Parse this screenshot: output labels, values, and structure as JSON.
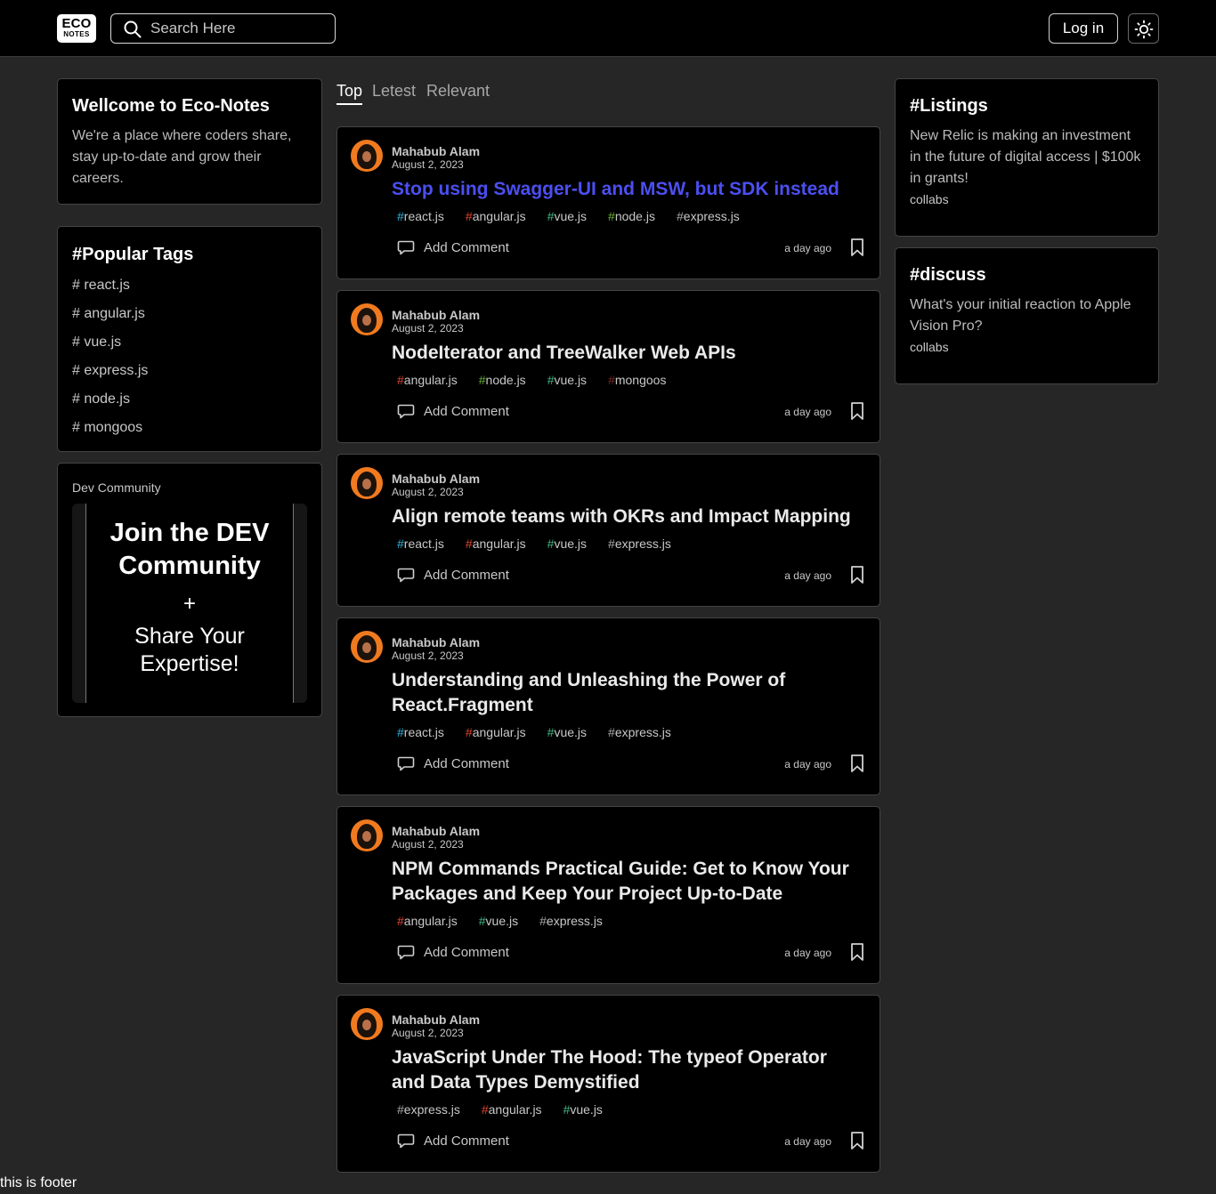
{
  "header": {
    "logo_top": "ECO",
    "logo_bottom": "NOTES",
    "search_placeholder": "Search Here",
    "login_label": "Log in"
  },
  "welcome": {
    "title": "Wellcome to Eco-Notes",
    "text": "We're a place where coders share, stay up-to-date and grow their careers."
  },
  "popular_tags": {
    "title": "#Popular Tags",
    "items": [
      "# react.js",
      "# angular.js",
      "# vue.js",
      "# express.js",
      "# node.js",
      "# mongoos"
    ]
  },
  "dev_community": {
    "caption": "Dev Community",
    "headline": "Join the DEV Community",
    "plus": "+",
    "subline": "Share Your Expertise!"
  },
  "tabs": [
    "Top",
    "Letest",
    "Relevant"
  ],
  "posts": [
    {
      "author": "Mahabub Alam",
      "date": "August 2, 2023",
      "title": "Stop using Swagger-UI and MSW, but SDK instead",
      "tags": [
        "react.js",
        "angular.js",
        "vue.js",
        "node.js",
        "express.js"
      ],
      "comment_label": "Add Comment",
      "time_ago": "a day ago"
    },
    {
      "author": "Mahabub Alam",
      "date": "August 2, 2023",
      "title": "NodeIterator and TreeWalker Web APIs",
      "tags": [
        "angular.js",
        "node.js",
        "vue.js",
        "mongoos"
      ],
      "comment_label": "Add Comment",
      "time_ago": "a day ago"
    },
    {
      "author": "Mahabub Alam",
      "date": "August 2, 2023",
      "title": "Align remote teams with OKRs and Impact Mapping",
      "tags": [
        "react.js",
        "angular.js",
        "vue.js",
        "express.js"
      ],
      "comment_label": "Add Comment",
      "time_ago": "a day ago"
    },
    {
      "author": "Mahabub Alam",
      "date": "August 2, 2023",
      "title": "Understanding and Unleashing the Power of React.Fragment",
      "tags": [
        "react.js",
        "angular.js",
        "vue.js",
        "express.js"
      ],
      "comment_label": "Add Comment",
      "time_ago": "a day ago"
    },
    {
      "author": "Mahabub Alam",
      "date": "August 2, 2023",
      "title": "NPM Commands Practical Guide: Get to Know Your Packages and Keep Your Project Up-to-Date",
      "tags": [
        "angular.js",
        "vue.js",
        "express.js"
      ],
      "comment_label": "Add Comment",
      "time_ago": "a day ago"
    },
    {
      "author": "Mahabub Alam",
      "date": "August 2, 2023",
      "title": "JavaScript Under The Hood: The typeof Operator and Data Types Demystified",
      "tags": [
        "express.js",
        "angular.js",
        "vue.js"
      ],
      "comment_label": "Add Comment",
      "time_ago": "a day ago"
    }
  ],
  "listings": {
    "title": "#Listings",
    "text": "New Relic is making an investment in the future of digital access | $100k in grants!",
    "meta": "collabs"
  },
  "discuss": {
    "title": "#discuss",
    "text": "What's your initial reaction to Apple Vision Pro?",
    "meta": "collabs"
  },
  "footer": {
    "text": "this is footer"
  },
  "colors": {
    "page_bg": "#262626",
    "card_bg": "#000000",
    "link_title": "#4c4ff0",
    "react": "#2fb3e0",
    "angular": "#e0442f",
    "vue": "#42b883",
    "node": "#69b034",
    "express": "#a8a8a8",
    "mongoos": "#7a2a2a"
  },
  "icons": [
    "search-icon",
    "sun-icon",
    "comment-icon",
    "bookmark-icon",
    "avatar"
  ]
}
